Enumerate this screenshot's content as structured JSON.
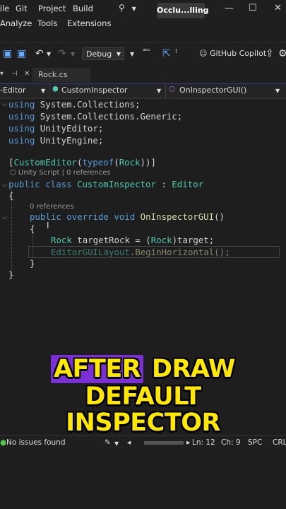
{
  "menu": {
    "row1": [
      "File",
      "Git",
      "Project",
      "Build"
    ],
    "row2": [
      "Analyze",
      "Tools",
      "Extensions"
    ],
    "solution_title": "Occlu...lling"
  },
  "toolbar": {
    "config": "Debug",
    "copilot": "GitHub Copilot"
  },
  "tab": {
    "name": "Rock.cs"
  },
  "navbar": {
    "project": "-Editor",
    "class": "CustomInspector",
    "member": "OnInspectorGUI()"
  },
  "code": {
    "line1": [
      "using",
      " System.Collections;"
    ],
    "line2": [
      "using",
      " System.Collections.Generic;"
    ],
    "line3": [
      "using",
      " UnityEditor;"
    ],
    "line4": [
      "using",
      " UnityEngine;"
    ],
    "attr": [
      "[",
      "CustomEditor",
      "(",
      "typeof",
      "(",
      "Rock",
      "))]"
    ],
    "lens1": "Unity Script | 0 references",
    "classdecl": [
      "public class ",
      "CustomInspector",
      " : ",
      "Editor"
    ],
    "brace_open": "{",
    "lens2": "0 references",
    "method": [
      "public override void ",
      "OnInspectorGUI",
      "()"
    ],
    "mbrace_open": "{",
    "stmt1": [
      "Rock",
      " targetRock = (",
      "Rock",
      ")target;"
    ],
    "stmt2": [
      "EditorGUILayout",
      ".",
      "BeginHorizontal",
      "();"
    ],
    "mbrace_close": "}",
    "brace_close": "}"
  },
  "caption": {
    "line1_hl": "AFTER",
    "line1_rest": " DRAW",
    "line2": "DEFAULT",
    "line3": "INSPECTOR"
  },
  "status": {
    "issues": "No issues found",
    "ln": "Ln: 12",
    "ch": "Ch: 9",
    "spc": "SPC",
    "crlf": "CRLF"
  },
  "colors": {
    "keyword": "#569cd6",
    "type": "#4ec9b0",
    "function": "#dcdcaa",
    "caption": "#ffe800",
    "caption_highlight": "#7b2fd6"
  }
}
